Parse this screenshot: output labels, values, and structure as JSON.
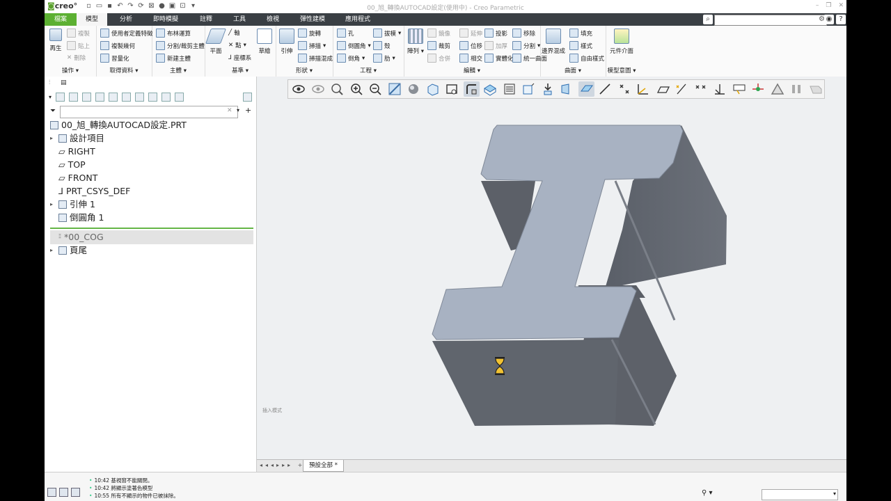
{
  "app": {
    "logo": "creo",
    "window_title": "00_旭_轉換AUTOCAD設定(使用中) - Creo Parametric"
  },
  "tabs": [
    {
      "label": "檔案"
    },
    {
      "label": "模型"
    },
    {
      "label": "分析"
    },
    {
      "label": "即時模擬"
    },
    {
      "label": "註釋"
    },
    {
      "label": "工具"
    },
    {
      "label": "檢視"
    },
    {
      "label": "彈性建模"
    },
    {
      "label": "應用程式"
    }
  ],
  "ribbon": {
    "operations": {
      "label": "操作",
      "regenerate": "再生",
      "copy": "複製",
      "paste": "貼上",
      "delete": "刪除"
    },
    "get_data": {
      "label": "取得資料",
      "udf": "使用者定義特徵",
      "copy_geom": "複製幾何",
      "shrinkwrap": "習量化"
    },
    "body": {
      "label": "主體",
      "boolean": "布林運算",
      "split": "分割/裁剪主體",
      "new_body": "新建主體"
    },
    "datum": {
      "label": "基準",
      "plane": "平面",
      "axis": "軸",
      "point": "點",
      "csys": "座標系",
      "sketch": "草繪"
    },
    "shapes": {
      "label": "形狀",
      "extrude": "引伸",
      "revolve": "旋轉",
      "sweep": "掃描",
      "swept_blend": "掃描混成"
    },
    "engineering": {
      "label": "工程",
      "hole": "孔",
      "draft": "拔模",
      "round": "倒圓角",
      "shell": "殼",
      "chamfer": "倒角",
      "rib": "肋"
    },
    "editing": {
      "label": "編輯",
      "pattern": "陣列",
      "mirror": "鏡像",
      "extend": "延伸",
      "project": "投影",
      "remove": "移除",
      "trim": "裁剪",
      "offset": "位移",
      "thicken": "加厚",
      "split": "分割",
      "merge": "合併",
      "intersect": "相交",
      "solidify": "實體化",
      "unify": "統一曲面"
    },
    "surfaces": {
      "label": "曲面",
      "boundary_blend": "邊界混成",
      "fill": "填充",
      "style": "樣式",
      "freestyle": "自由樣式"
    },
    "model_intent": {
      "label": "模型意圖",
      "component_interface": "元件介面"
    }
  },
  "tree": {
    "filter_placeholder": "",
    "root": "00_旭_轉換AUTOCAD設定.PRT",
    "items": [
      "設計項目",
      "RIGHT",
      "TOP",
      "FRONT",
      "PRT_CSYS_DEF",
      "引伸 1",
      "倒圓角 1"
    ],
    "cog": "*00_COG",
    "footer": "頁尾"
  },
  "graphics": {
    "insert_mode": "插入模式"
  },
  "sheet_tabs": {
    "active": "預設全部 *"
  },
  "status": {
    "messages": [
      "10:42 基視窗不能關閉。",
      "10:42 將顯示塗著色模型",
      "10:55 所有不顯示的物件已被抹除。"
    ]
  },
  "colors": {
    "file_tab": "#5cb032",
    "tabbar": "#3a3f44",
    "model_top": "#a8b2c2",
    "model_side": "#5e636c"
  }
}
